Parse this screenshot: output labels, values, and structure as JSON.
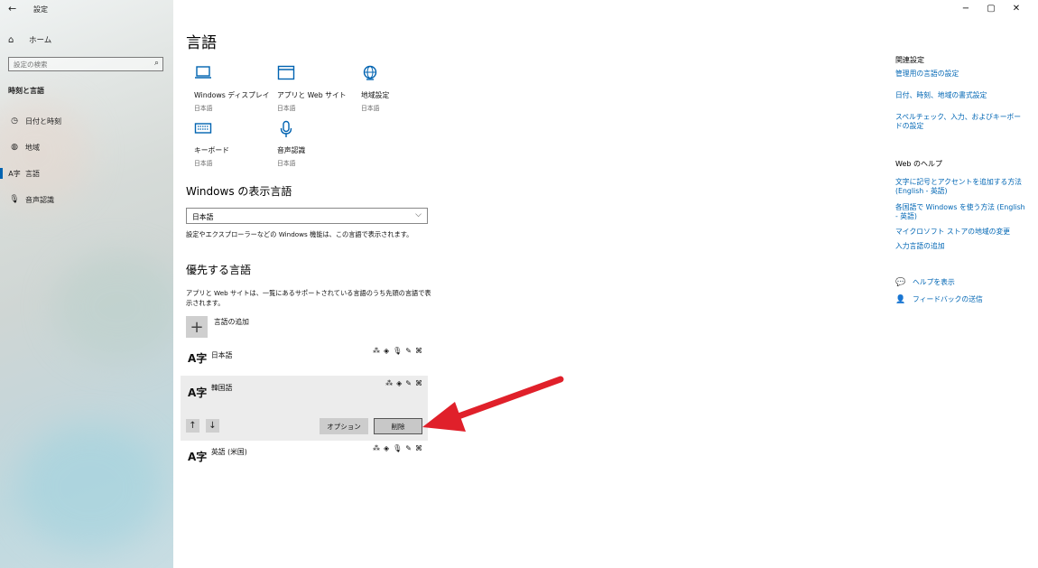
{
  "window": {
    "title": "設定",
    "back": "←",
    "controls": [
      "−",
      "▢",
      "✕"
    ]
  },
  "sidebar": {
    "home": "ホーム",
    "search_placeholder": "設定の検索",
    "section": "時刻と言語",
    "items": [
      {
        "label": "日付と時刻",
        "icon": "clock-icon"
      },
      {
        "label": "地域",
        "icon": "globe-icon"
      },
      {
        "label": "言語",
        "icon": "language-icon",
        "active": true
      },
      {
        "label": "音声認識",
        "icon": "microphone-icon"
      }
    ]
  },
  "main": {
    "title": "言語",
    "tiles": [
      {
        "name": "Windows ディスプレイ",
        "sub": "日本語",
        "icon": "monitor-icon"
      },
      {
        "name": "アプリと Web サイト",
        "sub": "日本語",
        "icon": "app-window-icon"
      },
      {
        "name": "地域設定",
        "sub": "日本語",
        "icon": "globe-settings-icon"
      },
      {
        "name": "キーボード",
        "sub": "日本語",
        "icon": "keyboard-icon"
      },
      {
        "name": "音声認識",
        "sub": "日本語",
        "icon": "microphone-icon"
      }
    ],
    "display_language": {
      "heading": "Windows の表示言語",
      "selected": "日本語",
      "description": "設定やエクスプローラーなどの Windows 機能は、この言語で表示されます。"
    },
    "preferred": {
      "heading": "優先する言語",
      "description_line1": "アプリと Web サイトは、一覧にあるサポートされている言語のうち先頭の言語で表",
      "description_line2": "示されます。",
      "add_label": "言語の追加",
      "languages": [
        {
          "name": "日本語"
        },
        {
          "name": "韓国語",
          "selected": true
        },
        {
          "name": "英語 (米国)"
        }
      ],
      "options_button": "オプション",
      "remove_button": "削除",
      "move_up": "↑",
      "move_down": "↓"
    }
  },
  "related": {
    "heading": "関連設定",
    "links": [
      "管理用の言語の設定",
      "日付、時刻、地域の書式設定",
      "スペルチェック、入力、およびキーボードの設定"
    ],
    "web_help_heading": "Web のヘルプ",
    "web_help_links": [
      "文字に記号とアクセントを追加する方法 (English - 英語)",
      "各国語で Windows を使う方法 (English - 英語)",
      "マイクロソフト ストアの地域の変更",
      "入力言語の追加"
    ],
    "help": "ヘルプを表示",
    "feedback": "フィードバックの送信"
  },
  "colors": {
    "accent": "#0063b1",
    "link": "#0066b4",
    "callout_arrow": "#e0202a"
  }
}
